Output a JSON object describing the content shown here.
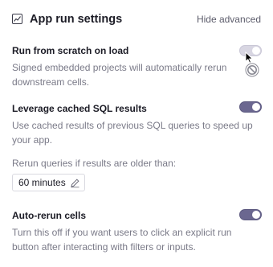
{
  "header": {
    "title": "App run settings",
    "icon": "chart-icon",
    "advanced_link": "Hide advanced"
  },
  "settings": [
    {
      "title": "Run from scratch on load",
      "description": "Signed embedded projects will automatically rerun downstream cells.",
      "enabled": false,
      "disabled": true
    },
    {
      "title": "Leverage cached SQL results",
      "description": "Use cached results of previous SQL queries to speed up your app.",
      "enabled": true
    },
    {
      "title": "Auto-rerun cells",
      "description": "Turn this off if you want users to click an explicit run button after interacting with filters or inputs.",
      "enabled": true
    }
  ],
  "cache": {
    "label": "Rerun queries if results are older than:",
    "value": "60 minutes",
    "edit_icon": "pencil-icon"
  },
  "colors": {
    "toggle_on": "#6b6790",
    "toggle_off": "#d8d6e2",
    "muted_text": "#7a7a88"
  }
}
